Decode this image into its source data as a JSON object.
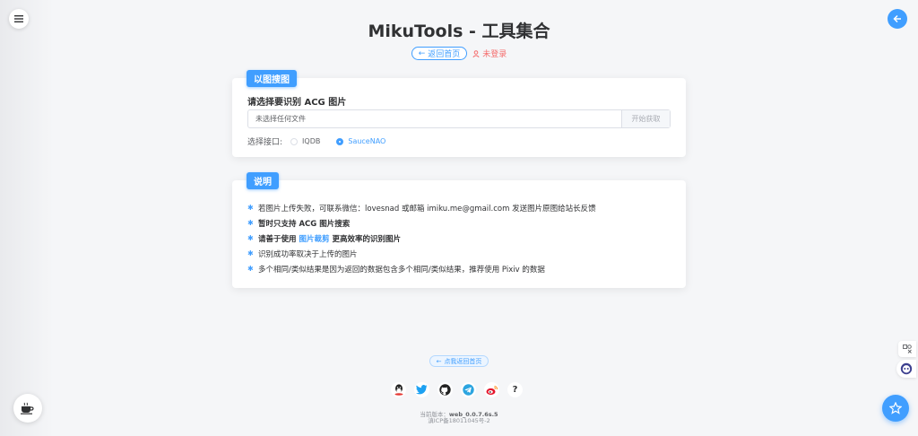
{
  "header": {
    "title": "MikuTools - 工具集合",
    "back_home": "返回首页",
    "login_status": "未登录"
  },
  "search_card": {
    "tag": "以图搜图",
    "heading": "请选择要识别 ACG 图片",
    "file_input_text": "未选择任何文件",
    "start_button": "开始获取",
    "api_label": "选择接口:",
    "options": [
      {
        "label": "IQDB",
        "selected": false
      },
      {
        "label": "SauceNAO",
        "selected": true
      }
    ]
  },
  "notes_card": {
    "tag": "说明",
    "items": [
      {
        "text": "若图片上传失败，可联系微信：lovesnad 或邮箱 imiku.me@gmail.com 发送图片原图给站长反馈"
      },
      {
        "text": "暂时只支持 ACG 图片搜索"
      },
      {
        "pre": "请善于使用 ",
        "link": "图片裁剪",
        "post": " 更高效率的识别图片"
      },
      {
        "text": "识别成功率取决于上传的图片"
      },
      {
        "text": "多个相同/类似结果是因为返回的数据包含多个相同/类似结果，推荐使用 Pixiv 的数据"
      }
    ]
  },
  "footer": {
    "back_home": "点我返回首页",
    "version_label": "当前版本：",
    "version_value": "web_0.0.7.6s.5",
    "icp": "滇ICP备18011045号-2",
    "social": [
      "qq-icon",
      "twitter-icon",
      "github-icon",
      "telegram-icon",
      "weibo-icon",
      "help-icon"
    ],
    "help_glyph": "?"
  },
  "colors": {
    "primary": "#409eff",
    "danger": "#f56c6c",
    "background": "#f5f6f8"
  }
}
